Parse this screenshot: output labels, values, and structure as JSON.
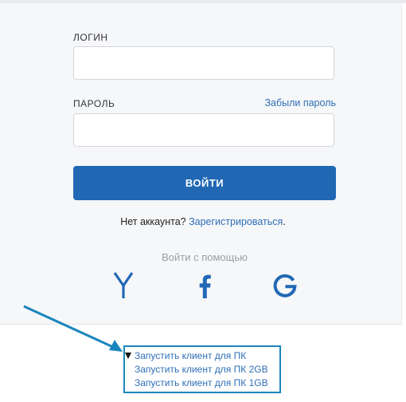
{
  "login": {
    "username_label": "ЛОГИН",
    "username_value": "",
    "password_label": "ПАРОЛЬ",
    "password_value": "",
    "forgot_link": "Забыли пароль",
    "submit_label": "ВОЙТИ",
    "no_account_text": "Нет аккаунта?",
    "register_link": "Зарегистрироваться",
    "register_suffix": "."
  },
  "social": {
    "caption": "Войти с помощью",
    "providers": [
      {
        "name": "yandex",
        "icon": "yandex-icon"
      },
      {
        "name": "facebook",
        "icon": "facebook-icon"
      },
      {
        "name": "google",
        "icon": "google-icon"
      }
    ]
  },
  "client_launch": {
    "items": [
      "Запустить клиент для ПК",
      "Запустить клиент для ПК 2GB",
      "Запустить клиент для ПК 1GB"
    ],
    "expanded": true
  },
  "colors": {
    "accent": "#2168b4",
    "link": "#2e6fb7",
    "panel_bg": "#f6f7f9",
    "annotation": "#1a86bd"
  }
}
